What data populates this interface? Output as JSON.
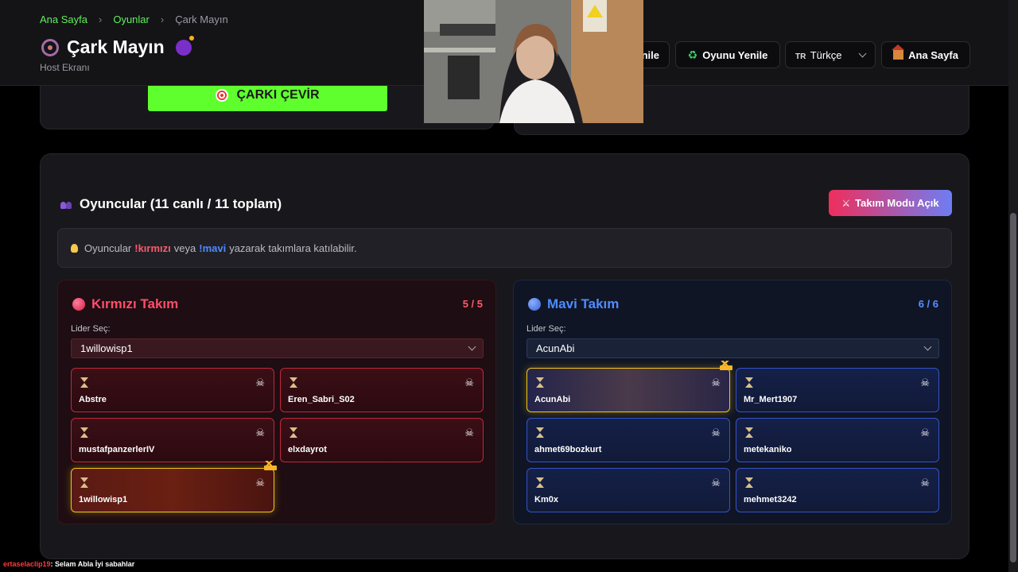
{
  "breadcrumb": {
    "home": "Ana Sayfa",
    "games": "Oyunlar",
    "current": "Çark Mayın"
  },
  "header": {
    "title": "Çark Mayın",
    "subtitle": "Host Ekranı",
    "cut_button_label": "nile",
    "refresh_label": "Oyunu Yenile",
    "language_code": "TR",
    "language_label": "Türkçe",
    "home_label": "Ana Sayfa"
  },
  "spin_button_label": "ÇARKI ÇEVİR",
  "players": {
    "title": "Oyuncular (11 canlı / 11 toplam)",
    "team_mode_label": "Takım Modu Açık",
    "info": {
      "prefix": "Oyuncular",
      "red_cmd": "!kırmızı",
      "or": "veya",
      "blue_cmd": "!mavi",
      "suffix": "yazarak takımlara katılabilir."
    }
  },
  "teams": {
    "red": {
      "name": "Kırmızı Takım",
      "count": "5 / 5",
      "leader_label": "Lider Seç:",
      "leader": "1willowisp1",
      "members": [
        "Abstre",
        "Eren_Sabri_S02",
        "mustafpanzerlerIV",
        "elxdayrot",
        "1willowisp1"
      ]
    },
    "blue": {
      "name": "Mavi Takım",
      "count": "6 / 6",
      "leader_label": "Lider Seç:",
      "leader": "AcunAbi",
      "members": [
        "AcunAbi",
        "Mr_Mert1907",
        "ahmet69bozkurt",
        "metekaniko",
        "Km0x",
        "mehmet3242"
      ]
    }
  },
  "chat": {
    "user": "ertaselaclip19",
    "message": ": Selam Abla İyi sabahlar"
  },
  "colors": {
    "accent_green": "#5fff2e",
    "red_team": "#ff4d6a",
    "blue_team": "#4f8bff",
    "leader_gold": "#f5c518"
  },
  "icons": {
    "title_left": "wheel-icon",
    "title_right": "bomb-icon",
    "card_status": "hourglass-icon",
    "card_action": "skull-crossbones-icon",
    "leader_mark": "crown-icon"
  }
}
